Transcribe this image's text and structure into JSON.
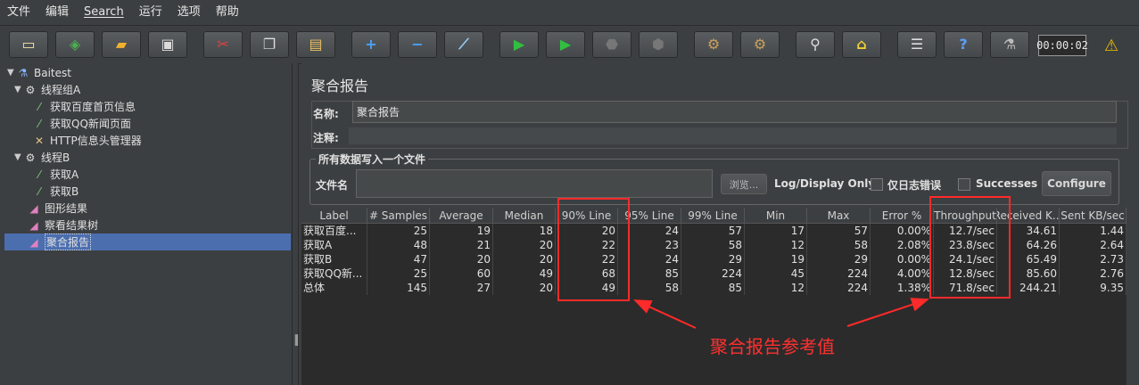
{
  "menu": [
    "文件",
    "编辑",
    "Search",
    "运行",
    "选项",
    "帮助"
  ],
  "toolbar": {
    "timer": "00:00:02",
    "icons": [
      "new-icon",
      "templates-icon",
      "open-icon",
      "save-icon",
      "cut-icon",
      "copy-icon",
      "paste-icon",
      "expand-icon",
      "collapse-icon",
      "toggle-icon",
      "start-icon",
      "start-no-pause-icon",
      "stop-icon",
      "shutdown-icon",
      "clear-icon",
      "clear-all-icon",
      "search-icon",
      "reset-search-icon",
      "function-helper-icon",
      "help-icon",
      "remote-icon"
    ]
  },
  "tree": {
    "items": [
      {
        "label": "Baitest",
        "icon": "flask-icon"
      },
      {
        "label": "线程组A",
        "icon": "gear-icon"
      },
      {
        "label": "获取百度首页信息",
        "icon": "pipette-icon"
      },
      {
        "label": "获取QQ新闻页面",
        "icon": "pipette-icon"
      },
      {
        "label": "HTTP信息头管理器",
        "icon": "wrench-icon"
      },
      {
        "label": "线程B",
        "icon": "gear-icon"
      },
      {
        "label": "获取A",
        "icon": "pipette-icon"
      },
      {
        "label": "获取B",
        "icon": "pipette-icon"
      },
      {
        "label": "图形结果",
        "icon": "graph-icon"
      },
      {
        "label": "察看结果树",
        "icon": "graph-icon"
      },
      {
        "label": "聚合报告",
        "icon": "graph-icon"
      }
    ]
  },
  "panel": {
    "title": "聚合报告",
    "name_label": "名称:",
    "name_value": "聚合报告",
    "comment_label": "注释:",
    "comment_value": "",
    "group_title": "所有数据写入一个文件",
    "filename_label": "文件名",
    "filename_value": "",
    "browse_label": "浏览...",
    "log_display_label": "Log/Display Only:",
    "errors_only_label": "仅日志错误",
    "successes_label": "Successes",
    "configure_label": "Configure"
  },
  "table": {
    "headers": [
      "Label",
      "# Samples",
      "Average",
      "Median",
      "90% Line",
      "95% Line",
      "99% Line",
      "Min",
      "Max",
      "Error %",
      "Throughput",
      "Received K...",
      "Sent KB/sec"
    ],
    "rows": [
      [
        "获取百度...",
        "25",
        "19",
        "18",
        "20",
        "24",
        "57",
        "17",
        "57",
        "0.00%",
        "12.7/sec",
        "34.61",
        "1.44"
      ],
      [
        "获取A",
        "48",
        "21",
        "20",
        "22",
        "23",
        "58",
        "12",
        "58",
        "2.08%",
        "23.8/sec",
        "64.26",
        "2.64"
      ],
      [
        "获取B",
        "47",
        "20",
        "20",
        "22",
        "24",
        "29",
        "19",
        "29",
        "0.00%",
        "24.1/sec",
        "65.49",
        "2.73"
      ],
      [
        "获取QQ新...",
        "25",
        "60",
        "49",
        "68",
        "85",
        "224",
        "45",
        "224",
        "4.00%",
        "12.8/sec",
        "85.60",
        "2.76"
      ],
      [
        "总体",
        "145",
        "27",
        "20",
        "49",
        "58",
        "85",
        "12",
        "224",
        "1.38%",
        "71.8/sec",
        "244.21",
        "9.35"
      ]
    ]
  },
  "annotation": {
    "text": "聚合报告参考值",
    "color": "#ff2a2a"
  }
}
